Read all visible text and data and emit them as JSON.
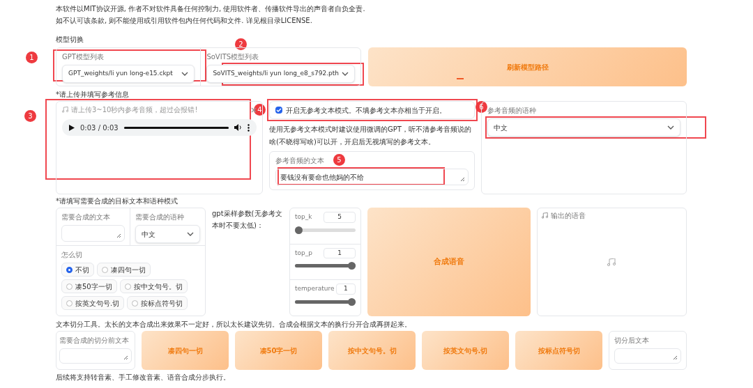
{
  "notice": [
    "本软件以MIT协议开源, 作者不对软件具备任何控制力, 使用软件者、传播软件导出的声音者自负全责.",
    "如不认可该条款, 则不能使用或引用软件包内任何代码和文件. 详见根目录LICENSE."
  ],
  "model_section": {
    "title": "模型切换",
    "gpt": {
      "label": "GPT模型列表",
      "value": "GPT_weights/li yun long-e15.ckpt"
    },
    "sovits": {
      "label": "SoVITS模型列表",
      "value": "SoVITS_weights/li yun long_e8_s792.pth"
    },
    "refresh_button": "刷新模型路径"
  },
  "reference_section": {
    "title": "*请上传并填写参考信息",
    "audio": {
      "label": "请上传3~10秒内参考音频，超过会报错!",
      "time": "0:03 / 0:03",
      "level": 1
    },
    "no_ref_mode": {
      "label": "开启无参考文本模式。不填参考文本亦相当于开启。",
      "checked": true
    },
    "note": "使用无参考文本模式时建议使用微调的GPT，听不清参考音频说的啥(不晓得写啥)可以开，开启后无视填写的参考文本。",
    "ref_text": {
      "label": "参考音频的文本",
      "value": "要钱没有要命也他妈的不给"
    },
    "ref_lang": {
      "label": "参考音频的语种",
      "value": "中文"
    }
  },
  "synthesis_section": {
    "title": "*请填写需要合成的目标文本和语种模式",
    "target_text": {
      "label": "需要合成的文本"
    },
    "target_lang": {
      "label": "需要合成的语种",
      "value": "中文"
    },
    "cut": {
      "label": "怎么切",
      "options": [
        {
          "label": "不切",
          "selected": true
        },
        {
          "label": "凑四句一切",
          "selected": false
        },
        {
          "label": "凑50字一切",
          "selected": false
        },
        {
          "label": "按中文句号。切",
          "selected": false
        },
        {
          "label": "按英文句号.切",
          "selected": false
        },
        {
          "label": "按标点符号切",
          "selected": false
        }
      ]
    },
    "gpt_params_label": "gpt采样参数(无参考文本时不要太低)：",
    "sliders": [
      {
        "name": "top_k",
        "value": "5",
        "level": 0
      },
      {
        "name": "top_p",
        "value": "1",
        "level": 1
      },
      {
        "name": "temperature",
        "value": "1",
        "level": 1
      }
    ],
    "synth_button": "合成语音",
    "output": {
      "label": "输出的语音"
    }
  },
  "cut_tool": {
    "description": "文本切分工具。太长的文本合成出来效果不一定好，所以太长建议先切。合成会根据文本的换行分开合成再拼起来。",
    "input_label": "需要合成的切分前文本",
    "buttons": [
      "凑四句一切",
      "凑50字一切",
      "按中文句号。切",
      "按英文句号.切",
      "按标点符号切"
    ],
    "output_label": "切分后文本"
  },
  "footer": "后续将支持转音素、手工修改音素、语音合成分步执行。",
  "annotations": [
    {
      "number": "1"
    },
    {
      "number": "2"
    },
    {
      "number": "3"
    },
    {
      "number": "4"
    },
    {
      "number": "5"
    },
    {
      "number": "6"
    }
  ]
}
